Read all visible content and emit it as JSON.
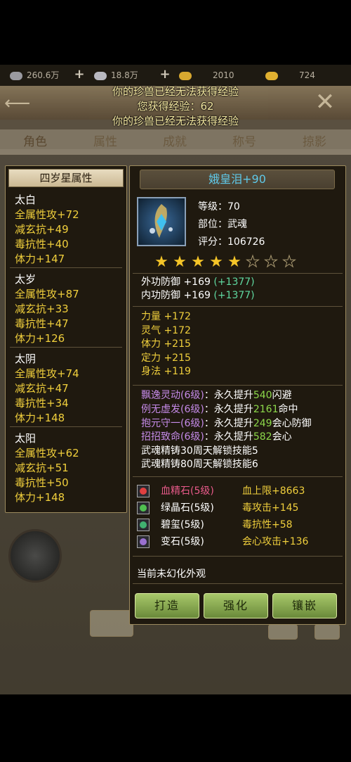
{
  "resources": [
    {
      "icon": "silver-coin-icon",
      "value": "260.6万"
    },
    {
      "icon": "silver-ingot-icon",
      "value": "18.8万"
    },
    {
      "icon": "gold-ingot-icon",
      "value": "2010"
    },
    {
      "icon": "gold-bar-icon",
      "value": "724"
    }
  ],
  "messages": [
    "你的珍兽已经无法获得经验",
    "您获得经验：62",
    "你的珍兽已经无法获得经验"
  ],
  "tabs": [
    "角色",
    "属性",
    "成就",
    "称号",
    "掠影"
  ],
  "left_panel": {
    "title": "四岁星属性",
    "groups": [
      {
        "name": "太白",
        "lines": [
          "全属性攻+72",
          "减玄抗+49",
          "毒抗性+40",
          "体力+147"
        ]
      },
      {
        "name": "太岁",
        "lines": [
          "全属性攻+87",
          "减玄抗+33",
          "毒抗性+47",
          "体力+126"
        ]
      },
      {
        "name": "太阴",
        "lines": [
          "全属性攻+74",
          "减玄抗+47",
          "毒抗性+34",
          "体力+148"
        ]
      },
      {
        "name": "太阳",
        "lines": [
          "全属性攻+62",
          "减玄抗+51",
          "毒抗性+50",
          "体力+148"
        ]
      }
    ]
  },
  "item": {
    "name": "娥皇泪+90",
    "level": "等级：70",
    "slot": "部位：武魂",
    "score": "评分：106726",
    "stars_total": 8,
    "stars_on": 5,
    "defense": [
      {
        "label": "外功防御 +169",
        "bonus": "(+1377)"
      },
      {
        "label": "内功防御 +169",
        "bonus": "(+1377)"
      }
    ],
    "attrs": [
      "力量 +172",
      "灵气 +172",
      "体力 +215",
      "定力 +215",
      "身法 +119"
    ],
    "skills": [
      {
        "name": "飘逸灵动(6级)",
        "pre": "：永久提升",
        "num": "540",
        "post": "闪避"
      },
      {
        "name": "例无虚发(6级)",
        "pre": "：永久提升",
        "num": "2161",
        "post": "命中"
      },
      {
        "name": "抱元守一(6级)",
        "pre": "：永久提升",
        "num": "249",
        "post": "会心防御"
      },
      {
        "name": "招招致命(6级)",
        "pre": "：永久提升",
        "num": "582",
        "post": "会心"
      }
    ],
    "unlocks": [
      "武魂精铸30周天解锁技能5",
      "武魂精铸80周天解锁技能6"
    ],
    "gems": [
      {
        "icon": "blood-gem-icon",
        "name": "血精石(5级)",
        "effect": "血上限+8663",
        "color": "#e85a8a",
        "dot": "#e04040"
      },
      {
        "icon": "green-gem-icon",
        "name": "绿晶石(5级)",
        "effect": "毒攻击+145",
        "color": "#ffffff",
        "dot": "#50c050"
      },
      {
        "icon": "jade-gem-icon",
        "name": "碧玺(5级)",
        "effect": "毒抗性+58",
        "color": "#ffffff",
        "dot": "#40b070"
      },
      {
        "icon": "change-gem-icon",
        "name": "变石(5级)",
        "effect": "会心攻击+136",
        "color": "#ffffff",
        "dot": "#9a70d0"
      }
    ],
    "appearance": "当前未幻化外观"
  },
  "buttons": [
    "打造",
    "强化",
    "镶嵌"
  ],
  "colors": {
    "gold_text": "#f0cf3c",
    "cyan_title": "#5fc8e8",
    "green_bonus": "#5fd8a0",
    "purple_skill": "#c58ae8"
  }
}
